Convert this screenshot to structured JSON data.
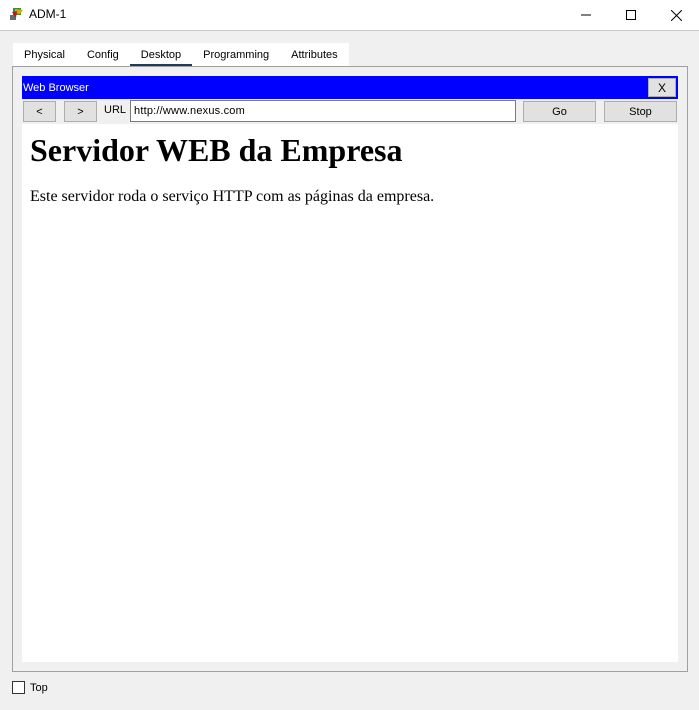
{
  "window": {
    "title": "ADM-1",
    "icon": "packet-tracer-pc-icon"
  },
  "tabs": [
    {
      "label": "Physical",
      "active": false
    },
    {
      "label": "Config",
      "active": false
    },
    {
      "label": "Desktop",
      "active": true
    },
    {
      "label": "Programming",
      "active": false
    },
    {
      "label": "Attributes",
      "active": false
    }
  ],
  "browser": {
    "title": "Web Browser",
    "close_label": "X",
    "back_label": "<",
    "forward_label": ">",
    "url_label": "URL",
    "url_value": "http://www.nexus.com",
    "go_label": "Go",
    "stop_label": "Stop",
    "title_color": "#0000ff"
  },
  "page": {
    "heading": "Servidor WEB da Empresa",
    "paragraph": "Este servidor roda o serviço HTTP com as páginas da empresa."
  },
  "footer": {
    "top_label": "Top",
    "top_checked": false
  }
}
